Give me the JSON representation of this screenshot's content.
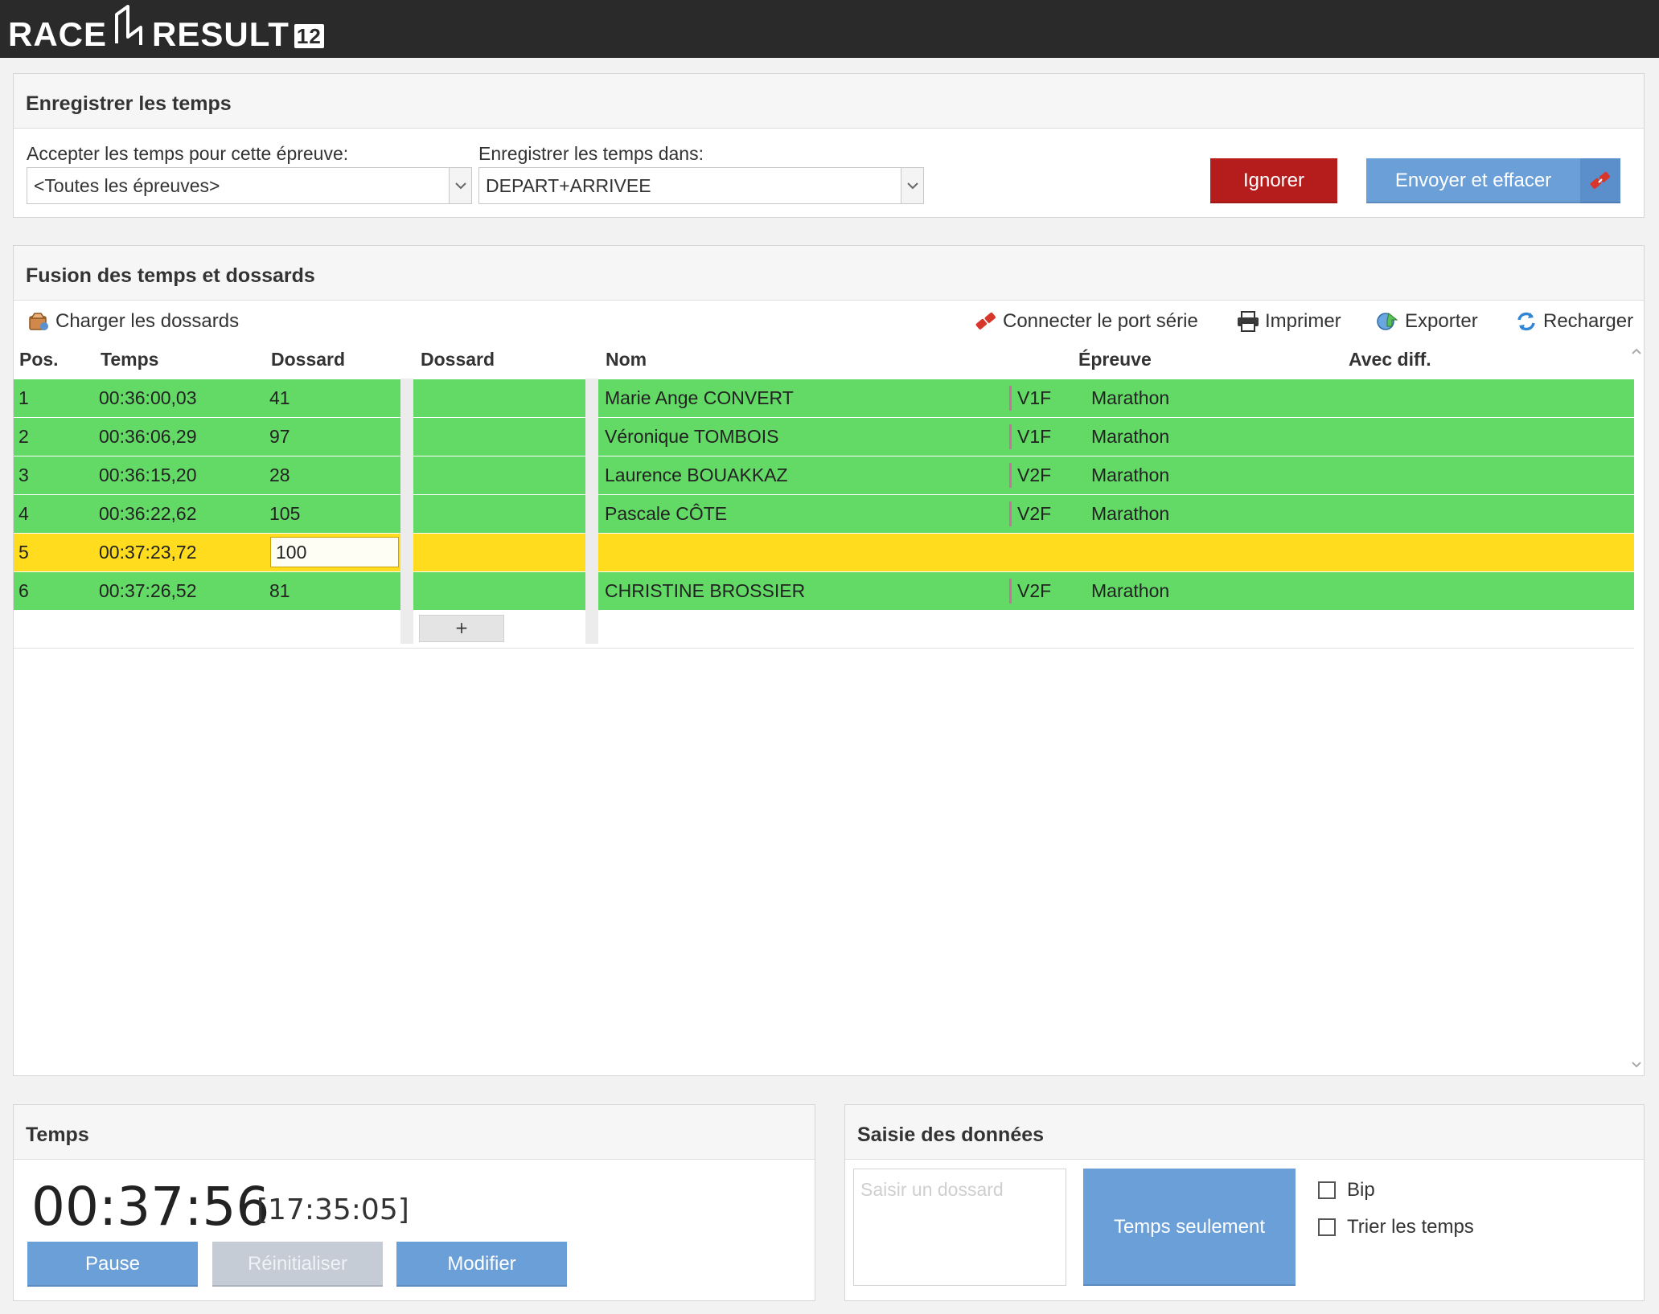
{
  "app": {
    "logo_race": "RACE",
    "logo_result": "RESULT",
    "logo_version": "12"
  },
  "record_panel": {
    "title": "Enregistrer les temps",
    "accept_label": "Accepter les temps pour cette épreuve:",
    "accept_value": "<Toutes les épreuves>",
    "store_label": "Enregistrer les temps dans:",
    "store_value": "DEPART+ARRIVEE",
    "ignore_label": "Ignorer",
    "send_label": "Envoyer et effacer"
  },
  "merge_panel": {
    "title": "Fusion des temps et dossards",
    "toolbar": {
      "load_bibs": "Charger les dossards",
      "connect_serial": "Connecter le port série",
      "print": "Imprimer",
      "export": "Exporter",
      "reload": "Recharger"
    },
    "columns": {
      "pos": "Pos.",
      "time": "Temps",
      "bib": "Dossard",
      "bib2": "Dossard",
      "name": "Nom",
      "event": "Épreuve",
      "with_diff": "Avec diff."
    },
    "rows": [
      {
        "pos": "1",
        "time": "00:36:00,03",
        "bib": "41",
        "name": "Marie Ange CONVERT",
        "cat": "V1F",
        "event": "Marathon",
        "status": "green"
      },
      {
        "pos": "2",
        "time": "00:36:06,29",
        "bib": "97",
        "name": "Véronique TOMBOIS",
        "cat": "V1F",
        "event": "Marathon",
        "status": "green"
      },
      {
        "pos": "3",
        "time": "00:36:15,20",
        "bib": "28",
        "name": "Laurence BOUAKKAZ",
        "cat": "V2F",
        "event": "Marathon",
        "status": "green"
      },
      {
        "pos": "4",
        "time": "00:36:22,62",
        "bib": "105",
        "name": "Pascale CÔTE",
        "cat": "V2F",
        "event": "Marathon",
        "status": "green"
      },
      {
        "pos": "5",
        "time": "00:37:23,72",
        "bib": "100",
        "name": "",
        "cat": "",
        "event": "",
        "status": "yellow"
      },
      {
        "pos": "6",
        "time": "00:37:26,52",
        "bib": "81",
        "name": "CHRISTINE BROSSIER",
        "cat": "V2F",
        "event": "Marathon",
        "status": "green"
      }
    ],
    "add_label": "+"
  },
  "time_panel": {
    "title": "Temps",
    "clock": "00:37:56",
    "clock_real": "[17:35:05]",
    "pause_label": "Pause",
    "reset_label": "Réinitialiser",
    "modify_label": "Modifier"
  },
  "entry_panel": {
    "title": "Saisie des données",
    "bib_placeholder": "Saisir un dossard",
    "time_only_label": "Temps seulement",
    "beep_label": "Bip",
    "sort_label": "Trier les temps"
  },
  "colors": {
    "topbar": "#2a2a2a",
    "row_ok": "#63d966",
    "row_pending": "#ffdc1e",
    "ignore": "#b51d1d",
    "primary": "#6a9fd8"
  }
}
